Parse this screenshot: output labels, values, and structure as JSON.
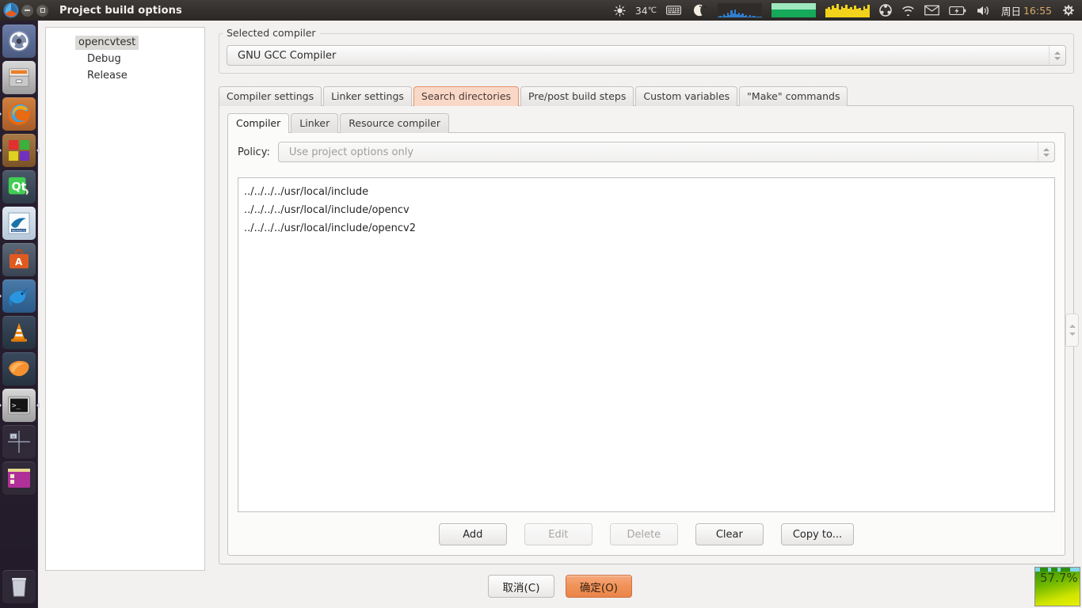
{
  "window": {
    "title": "Project build options",
    "logo_icon": "codeblocks-icon",
    "minimize_icon": "minimize-icon",
    "maximize_icon": "maximize-icon"
  },
  "tray": {
    "temperature": "34",
    "temperature_unit": "℃",
    "weather_icon": "sun-icon",
    "keyboard_icon": "keyboard-layout-icon",
    "moon_icon": "moon-icon",
    "cpu_graph_icon": "cpu-graph",
    "mem_graph_icon": "memory-graph",
    "net_graph_icon": "network-graph",
    "ubuntu_icon": "ubuntu-session-icon",
    "wifi_icon": "wifi-icon",
    "mail_icon": "mail-icon",
    "battery_icon": "battery-icon",
    "volume_icon": "volume-icon",
    "date": "周日",
    "time": "16:55",
    "power_icon": "power-gear-icon"
  },
  "launcher": {
    "items": [
      {
        "name": "dash-home",
        "icon": "ubuntu-dash-icon"
      },
      {
        "name": "files",
        "icon": "file-manager-icon"
      },
      {
        "name": "firefox",
        "icon": "firefox-icon"
      },
      {
        "name": "app-colored-squares",
        "icon": "blocks-icon"
      },
      {
        "name": "qt-creator",
        "icon": "qt-icon"
      },
      {
        "name": "mysql-workbench",
        "icon": "dolphin-workbench-icon"
      },
      {
        "name": "ubuntu-software-center",
        "icon": "software-center-icon"
      },
      {
        "name": "bluefish",
        "icon": "blue-bird-icon"
      },
      {
        "name": "vlc",
        "icon": "traffic-cone-icon"
      },
      {
        "name": "mango-app",
        "icon": "mango-icon"
      },
      {
        "name": "terminal",
        "icon": "terminal-icon"
      },
      {
        "name": "workspace-switcher",
        "icon": "workspace-icon"
      },
      {
        "name": "code-blocks-window",
        "icon": "purple-window-icon"
      },
      {
        "name": "trash",
        "icon": "trash-icon"
      }
    ]
  },
  "tree": {
    "root": "opencvtest",
    "children": [
      "Debug",
      "Release"
    ]
  },
  "compiler_group": {
    "legend": "Selected compiler",
    "selected": "GNU GCC Compiler"
  },
  "outer_tabs": [
    {
      "label": "Compiler settings",
      "active": false
    },
    {
      "label": "Linker settings",
      "active": false
    },
    {
      "label": "Search directories",
      "active": true
    },
    {
      "label": "Pre/post build steps",
      "active": false
    },
    {
      "label": "Custom variables",
      "active": false
    },
    {
      "label": "\"Make\" commands",
      "active": false
    }
  ],
  "inner_tabs": [
    {
      "label": "Compiler",
      "active": true
    },
    {
      "label": "Linker",
      "active": false
    },
    {
      "label": "Resource compiler",
      "active": false
    }
  ],
  "policy": {
    "label": "Policy:",
    "value": "Use project options only"
  },
  "directories": [
    "../../../../usr/local/include",
    "../../../../usr/local/include/opencv",
    "../../../../usr/local/include/opencv2"
  ],
  "list_buttons": [
    {
      "label": "Add",
      "disabled": false
    },
    {
      "label": "Edit",
      "disabled": true
    },
    {
      "label": "Delete",
      "disabled": true
    },
    {
      "label": "Clear",
      "disabled": false
    },
    {
      "label": "Copy to...",
      "disabled": false
    }
  ],
  "footer": {
    "cancel": "取消(C)",
    "ok": "确定(O)"
  },
  "conky": {
    "percent": "57.7%"
  },
  "colors": {
    "accent_orange": "#e9854a",
    "active_tab_bg": "#f9d8c8",
    "active_tab_border": "#e7916a",
    "panel_bg": "#f2f1f0",
    "tray_time": "#d9a86a"
  }
}
